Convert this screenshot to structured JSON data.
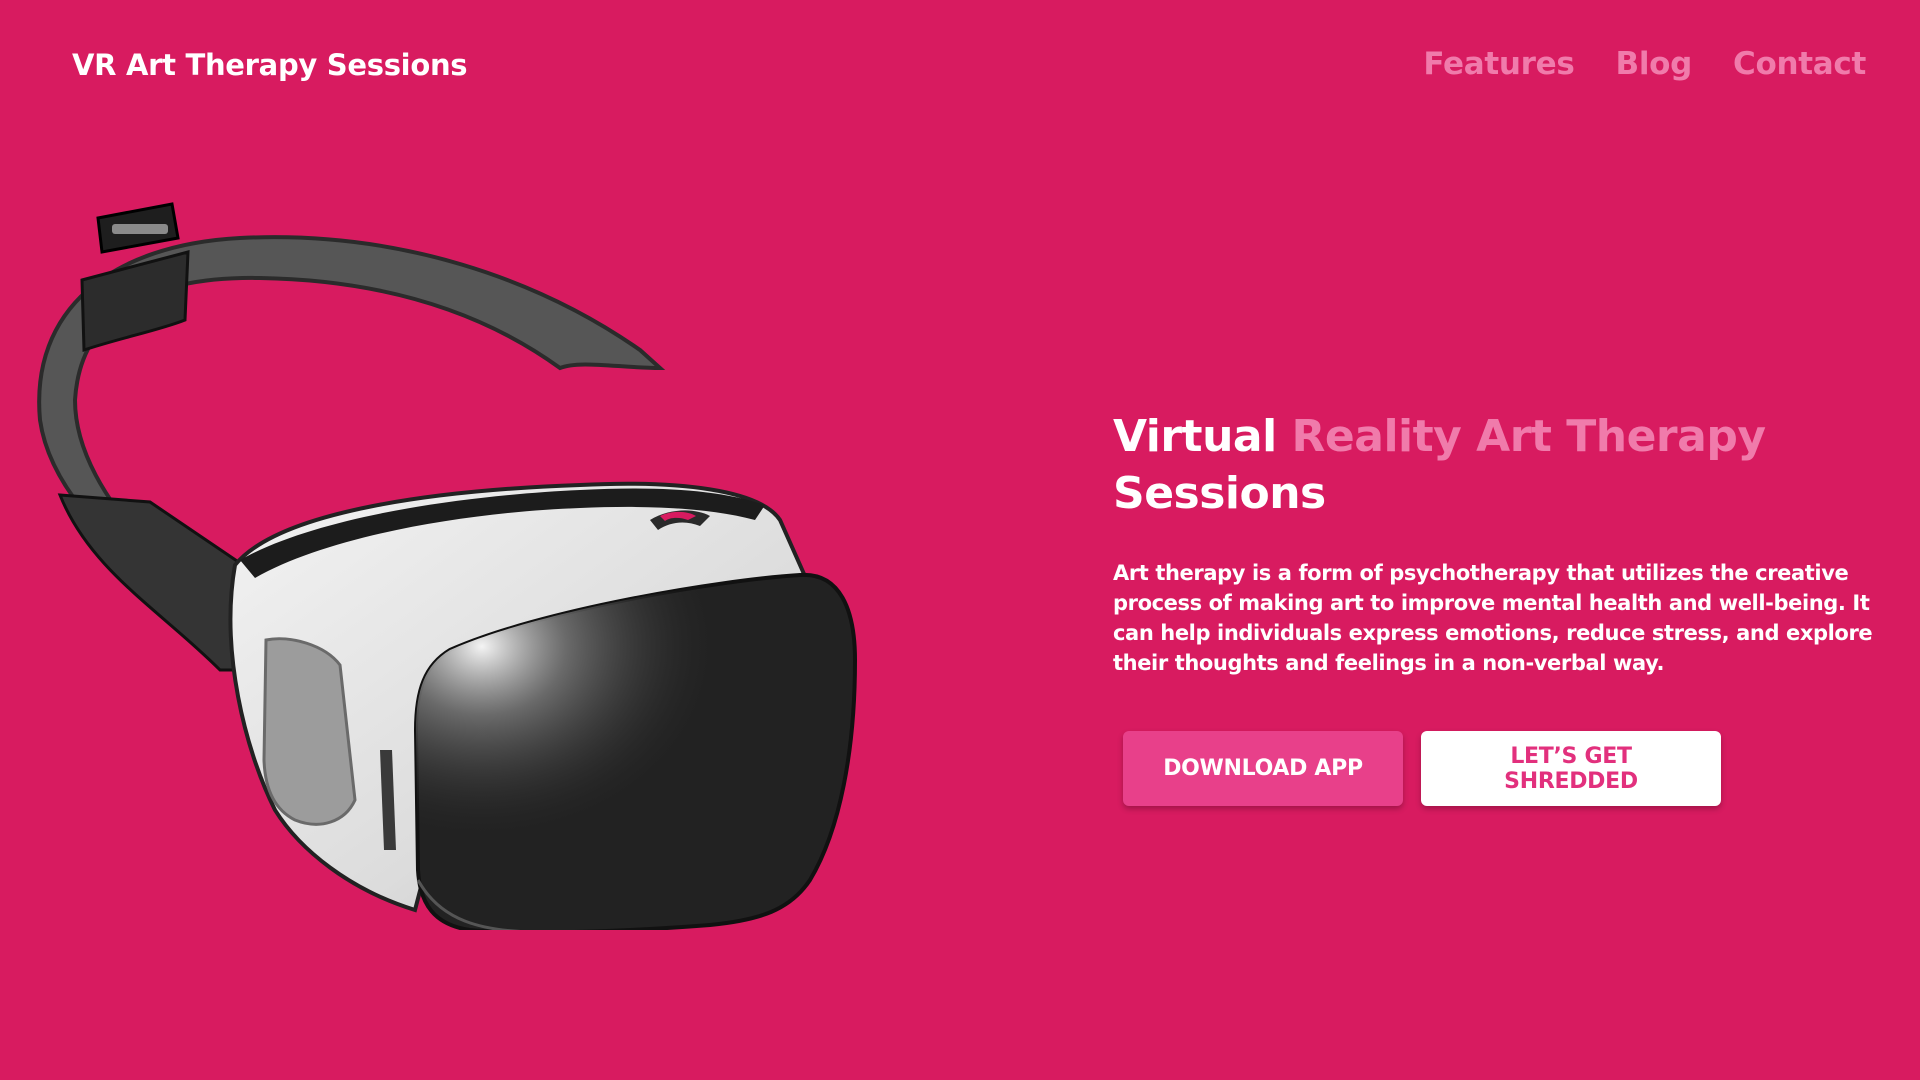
{
  "header": {
    "brand": "VR Art Therapy Sessions",
    "nav": [
      {
        "label": "Features"
      },
      {
        "label": "Blog"
      },
      {
        "label": "Contact"
      }
    ]
  },
  "hero": {
    "headline_part1": "Virtual",
    "headline_part2": "Reality Art Therapy",
    "headline_part3": "Sessions",
    "description": "Art therapy is a form of psychotherapy that utilizes the creative process of making art to improve mental health and well-being. It can help individuals express emotions, reduce stress, and explore their thoughts and feelings in a non-verbal way.",
    "primary_button": "DOWNLOAD APP",
    "secondary_button": "LET’S GET SHREDDED",
    "image_icon": "vr-headset-illustration"
  },
  "colors": {
    "background": "#d81b60",
    "accent_text": "#f07bab",
    "primary_button": "#e8408a",
    "secondary_button_text": "#e2307d"
  }
}
